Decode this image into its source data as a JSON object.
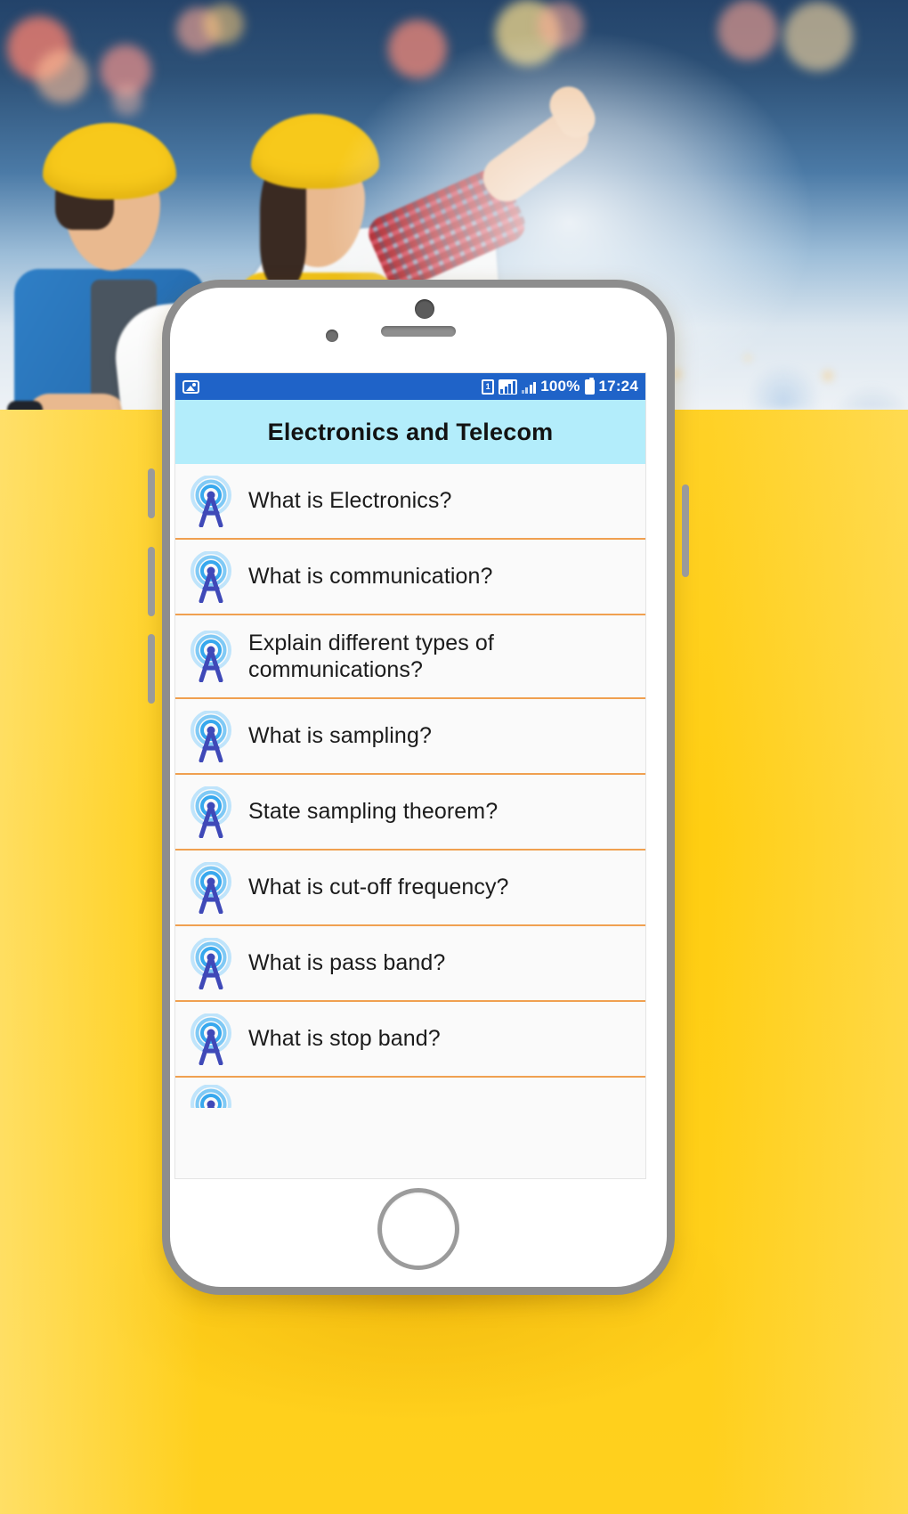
{
  "background": {
    "hero_alt": "two construction workers in yellow hard helmets with blueprint, woman pointing, blurred night city skyline",
    "page_color": "#FFD01E"
  },
  "phone": {
    "frame_color": "#8d8d8d",
    "home_button_label": "Home"
  },
  "statusbar": {
    "icons_left": [
      "photo-icon"
    ],
    "icons_right": [
      "sim-card-icon",
      "signal-full-icon",
      "signal-secondary-icon",
      "battery-icon"
    ],
    "battery_percent": "100%",
    "time": "17:24",
    "bg_color": "#1F63C8"
  },
  "app": {
    "title": "Electronics and Telecom",
    "title_bg_color": "#B3EDFB",
    "divider_color": "#F0A050",
    "list_bg_color": "#FAFAFA",
    "icon_name": "radio-tower-icon",
    "items": [
      {
        "label": "What is Electronics?"
      },
      {
        "label": "What is communication?"
      },
      {
        "label": " Explain different types of communications?"
      },
      {
        "label": "What is sampling?"
      },
      {
        "label": "State sampling theorem?"
      },
      {
        "label": "What is cut-off frequency?"
      },
      {
        "label": "What is pass band?"
      },
      {
        "label": "What is stop band?"
      },
      {
        "label": ""
      }
    ]
  }
}
